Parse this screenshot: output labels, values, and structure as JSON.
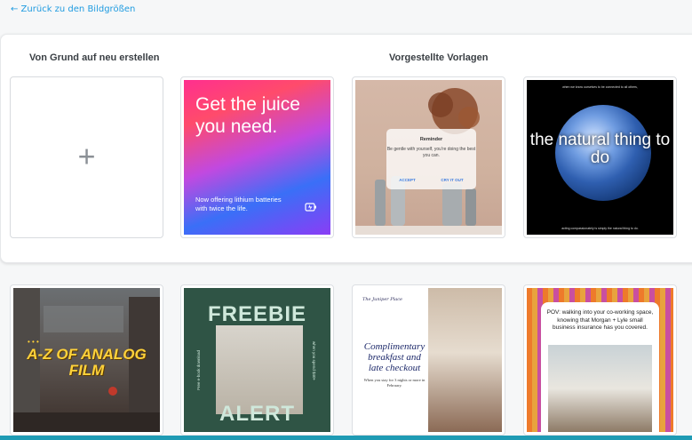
{
  "nav": {
    "back_label": "← Zurück zu den Bildgrößen"
  },
  "sections": {
    "scratch_title": "Von Grund auf neu erstellen",
    "templates_title": "Vorgestellte Vorlagen"
  },
  "blank": {
    "plus": "+"
  },
  "templates": {
    "juice": {
      "headline": "Get the juice you need.",
      "sub": "Now offering lithium batteries with twice the life."
    },
    "reminder": {
      "title": "Reminder",
      "message": "Be gentle with yourself, you're doing the best you can.",
      "accept": "ACCEPT",
      "cry": "CRY IT OUT"
    },
    "earth": {
      "top": "when we know ourselves to be connected to all others,",
      "main": "the natural thing to do",
      "bottom": "acting compassionately is simply the natural thing to do."
    },
    "film": {
      "dots": "• • •",
      "title": "A-Z OF ANALOG FILM"
    },
    "freebie": {
      "top": "FREEBIE",
      "bottom": "ALERT",
      "left": "Free e-book download",
      "right": "when you spend $40+"
    },
    "hotel": {
      "brand": "The Juniper Place",
      "headline": "Complimentary breakfast and late checkout",
      "sub": "When you stay for 3 nights or more in February."
    },
    "pov": {
      "text": "POV: walking into your co-working space, knowing that Morgan + Lyle small business insurance has you covered."
    }
  },
  "colors": {
    "accent": "#1f9be0",
    "bottom_bar": "#1f9bb4"
  }
}
